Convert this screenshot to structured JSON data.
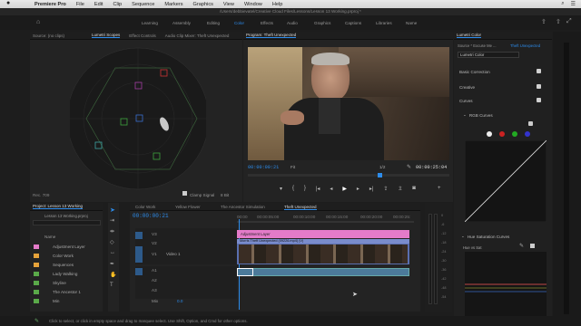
{
  "menubar": {
    "apple": "",
    "app": "Premiere Pro",
    "items": [
      "File",
      "Edit",
      "Clip",
      "Sequence",
      "Markers",
      "Graphics",
      "View",
      "Window",
      "Help"
    ]
  },
  "title_path": "/Users/debbievatel/Creative Cloud Files/Lessons/Lesson 13 Working.prproj *",
  "workspaces": [
    "Learning",
    "Assembly",
    "Editing",
    "Color",
    "Effects",
    "Audio",
    "Graphics",
    "Captions",
    "Libraries",
    "Name"
  ],
  "active_workspace": "Color",
  "source_panel": {
    "tabs": [
      "Source: (no clips)",
      "Lumetri Scopes",
      "Effect Controls",
      "Audio Clip Mixer: Theft Unexpected"
    ],
    "bottom": [
      "Rec. 709",
      "Clamp Signal",
      "8 Bit"
    ]
  },
  "program_panel": {
    "title": "Program: Theft Unexpected",
    "timecode": "00:00:00:21",
    "fit": "Fit",
    "scale": "1/2",
    "duration": "00:00:25:04"
  },
  "project_panel": {
    "tabs": [
      "Project: Lesson 13 Working"
    ],
    "file": "Lesson 13 Working.prproj",
    "col": "Name",
    "items": [
      {
        "name": "Adjustment Layer",
        "color": "#e47bc9"
      },
      {
        "name": "Color Work",
        "color": "#e7a33a"
      },
      {
        "name": "Sequences",
        "color": "#e7a33a"
      },
      {
        "name": "Lady Walking",
        "color": "#5aaa49"
      },
      {
        "name": "Skyline",
        "color": "#5aaa49"
      },
      {
        "name": "The Ancestor 1",
        "color": "#5aaa49"
      },
      {
        "name": "Min",
        "color": "#5aaa49"
      }
    ]
  },
  "timeline": {
    "tabs": [
      "Color Work",
      "Yellow Flower",
      "The Ancestor Simulation",
      "Theft Unexpected"
    ],
    "timecode": "00:00:00:21",
    "ruler": [
      "00:00",
      "00:00:05:00",
      "00:00:10:00",
      "00:00:15:00",
      "00:00:20:00",
      "00:00:25:"
    ],
    "tracks": [
      "V3",
      "V2",
      "V1",
      "A1",
      "A2",
      "A3"
    ],
    "adj_clip": "Adjustment Layer",
    "v1_label": "Video 1",
    "v1_clip": "Morris Theft Unexpected",
    "v1_clip2": "Morris Theft Unexpected (09226.mp4) (V)",
    "mix": "Mix",
    "mix_val": "0.0"
  },
  "lumetri": {
    "title": "Lumetri Color",
    "source": "Source * Excuse Me ...",
    "seq": "Theft Unexpected",
    "effect": "Lumetri Color",
    "sections": [
      "Basic Correction",
      "Creative",
      "Curves",
      "RGB Curves"
    ],
    "hue_section": "Hue Saturation Curves",
    "hue_label": "Hue vs Sat",
    "meter": [
      "0",
      "-6",
      "-12",
      "-18",
      "-24",
      "-30",
      "-36",
      "-42",
      "-48",
      "-54"
    ]
  },
  "status": "Click to select, or click in empty space and drag to marquee select. Use Shift, Option, and Cmd for other options."
}
